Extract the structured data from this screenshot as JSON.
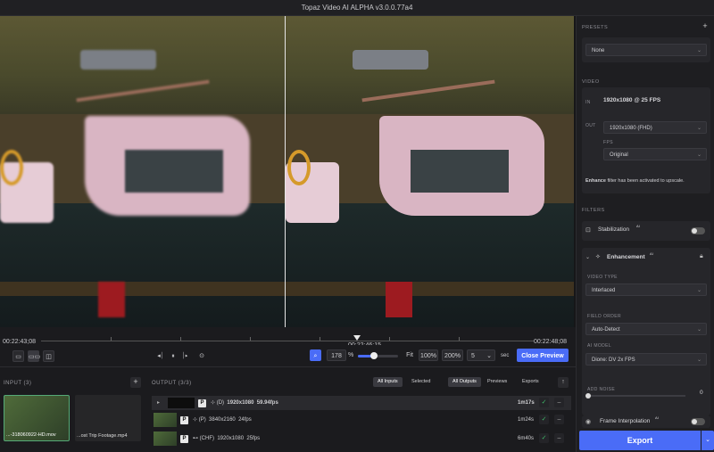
{
  "app": {
    "title": "Topaz Video AI ALPHA  v3.0.0.77a4"
  },
  "timeline": {
    "start": "00:22:43;08",
    "current": "00:22:46;15",
    "end": "00:22:48;08"
  },
  "controls": {
    "zoom_value": "178",
    "zoom_unit": "%",
    "fit": "Fit",
    "z100": "100%",
    "z200": "200%",
    "preview_seconds": "5",
    "sec_label": "sec",
    "close_preview": "Close Preview",
    "zoom_fraction": 0.4
  },
  "input": {
    "header": "INPUT (3)",
    "items": [
      {
        "name": "...-318060922-HD.mov"
      },
      {
        "name": "...ost Trip Footage.mp4"
      }
    ]
  },
  "output": {
    "header": "OUTPUT (3/3)",
    "tabs_inputs": [
      "All Inputs",
      "Selected"
    ],
    "tabs_outputs": [
      "All Outputs",
      "Previews",
      "Exports"
    ],
    "rows": [
      {
        "codec": "(D)",
        "resolution": "1920x1080",
        "fps": "59.94fps",
        "duration": "1m17s"
      },
      {
        "codec": "(P)",
        "resolution": "3840x2160",
        "fps": "24fps",
        "duration": "1m24s"
      },
      {
        "codec": "(CHF)",
        "resolution": "1920x1080",
        "fps": "25fps",
        "duration": "6m40s"
      }
    ]
  },
  "presets": {
    "header": "PRESETS",
    "value": "None"
  },
  "video": {
    "header": "VIDEO",
    "in_label": "IN",
    "in_value": "1920x1080 @ 25 FPS",
    "out_label": "OUT",
    "out_value": "1920x1080 (FHD)",
    "fps_label": "FPS",
    "fps_value": "Original",
    "note_bold": "Enhance",
    "note_rest": " filter has been activated to upscale."
  },
  "filters": {
    "header": "FILTERS",
    "stabilization": "Stabilization",
    "ai_tag": "AI",
    "enhancement": "Enhancement",
    "video_type_label": "VIDEO TYPE",
    "video_type": "Interlaced",
    "field_order_label": "FIELD ORDER",
    "field_order": "Auto-Detect",
    "ai_model_label": "AI MODEL",
    "ai_model": "Dione: DV 2x FPS",
    "add_noise_label": "ADD NOISE",
    "add_noise_value": "0",
    "frame_interpolation": "Frame Interpolation"
  },
  "export": {
    "label": "Export"
  }
}
